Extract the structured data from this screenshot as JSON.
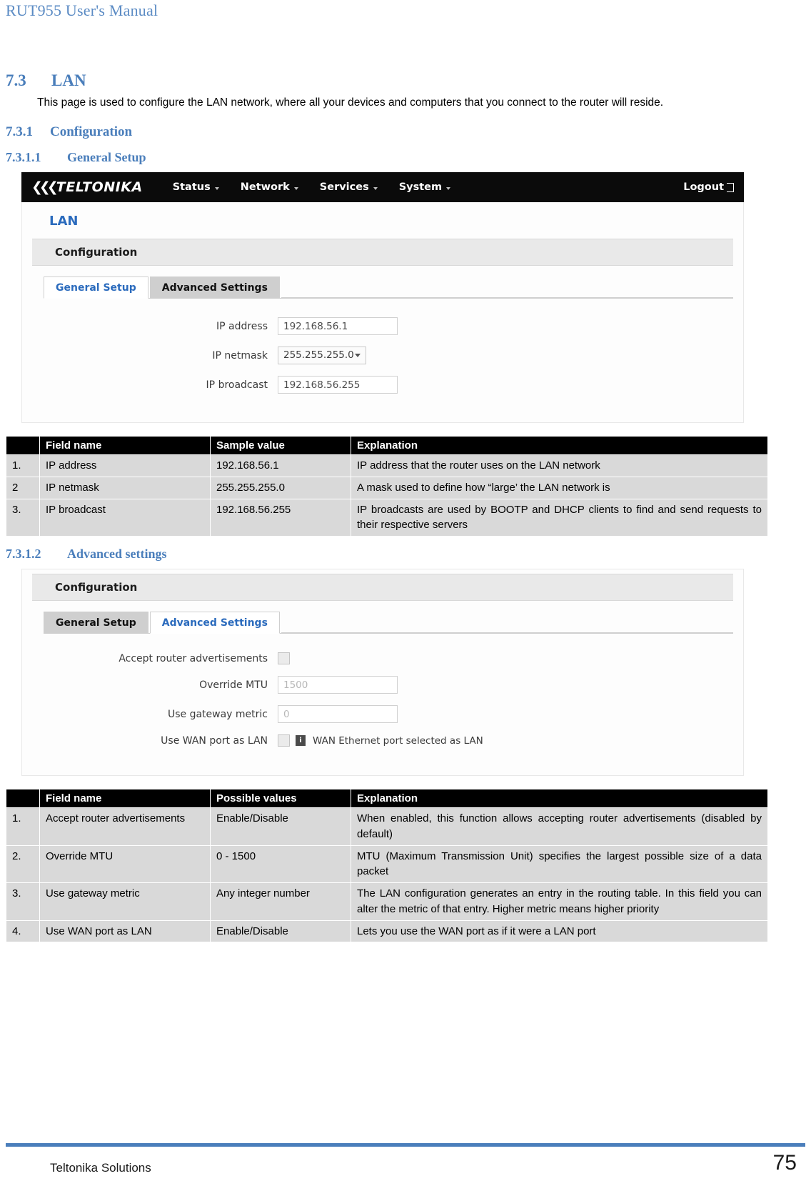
{
  "document": {
    "running_header": "RUT955 User's Manual",
    "footer_left": "Teltonika Solutions",
    "page_number": "75",
    "accent_color": "#4a7ebb"
  },
  "sections": {
    "lan": {
      "number": "7.3",
      "title": "LAN",
      "intro": "This page is used to configure the LAN network, where all your devices and computers that you connect to the router will reside."
    },
    "configuration": {
      "number": "7.3.1",
      "title": "Configuration"
    },
    "general_setup": {
      "number": "7.3.1.1",
      "title": "General Setup"
    },
    "advanced_settings": {
      "number": "7.3.1.2",
      "title": "Advanced settings"
    }
  },
  "screenshot_general": {
    "navbar": {
      "logo": "TELTONIKA",
      "menu": [
        {
          "label": "Status"
        },
        {
          "label": "Network"
        },
        {
          "label": "Services"
        },
        {
          "label": "System"
        }
      ],
      "logout": "Logout"
    },
    "page_title": "LAN",
    "panel_header": "Configuration",
    "tabs": [
      {
        "label": "General Setup",
        "active": true
      },
      {
        "label": "Advanced Settings",
        "active": false
      }
    ],
    "fields": {
      "ip_address": {
        "label": "IP address",
        "value": "192.168.56.1"
      },
      "ip_netmask": {
        "label": "IP netmask",
        "value": "255.255.255.0"
      },
      "ip_broadcast": {
        "label": "IP broadcast",
        "value": "192.168.56.255"
      }
    }
  },
  "screenshot_advanced": {
    "panel_header": "Configuration",
    "tabs": [
      {
        "label": "General Setup",
        "active": false
      },
      {
        "label": "Advanced Settings",
        "active": true
      }
    ],
    "fields": {
      "accept_router_advertisements": {
        "label": "Accept router advertisements"
      },
      "override_mtu": {
        "label": "Override MTU",
        "placeholder": "1500"
      },
      "use_gateway_metric": {
        "label": "Use gateway metric",
        "placeholder": "0"
      },
      "use_wan_port_as_lan": {
        "label": "Use WAN port as LAN",
        "hint": "WAN Ethernet port selected as LAN"
      }
    }
  },
  "table_general": {
    "headers": {
      "index": "",
      "name": "Field name",
      "value": "Sample value",
      "explanation": "Explanation"
    },
    "rows": [
      {
        "index": "1.",
        "name": "IP address",
        "value": "192.168.56.1",
        "explanation": "IP address that the router uses on the LAN network"
      },
      {
        "index": "2",
        "name": "IP netmask",
        "value": "255.255.255.0",
        "explanation": "A mask used to define how “large’ the LAN network is"
      },
      {
        "index": "3.",
        "name": "IP broadcast",
        "value": "192.168.56.255",
        "explanation": "IP broadcasts are used by BOOTP and DHCP clients to find and send requests to their respective servers"
      }
    ]
  },
  "table_advanced": {
    "headers": {
      "index": "",
      "name": "Field name",
      "value": "Possible values",
      "explanation": "Explanation"
    },
    "rows": [
      {
        "index": "1.",
        "name": "Accept router advertisements",
        "value": "Enable/Disable",
        "explanation": "When enabled, this function allows accepting router advertisements (disabled by default)"
      },
      {
        "index": "2.",
        "name": "Override MTU",
        "value": "0 - 1500",
        "explanation": "MTU (Maximum Transmission Unit) specifies the largest possible size of a data packet"
      },
      {
        "index": "3.",
        "name": "Use gateway metric",
        "value": "Any integer number",
        "explanation": "The LAN configuration generates an entry in the routing table. In this field you can alter the metric of that entry. Higher metric means higher priority"
      },
      {
        "index": "4.",
        "name": "Use WAN port as LAN",
        "value": "Enable/Disable",
        "explanation": "Lets you use the WAN port as if it were a LAN port"
      }
    ]
  }
}
